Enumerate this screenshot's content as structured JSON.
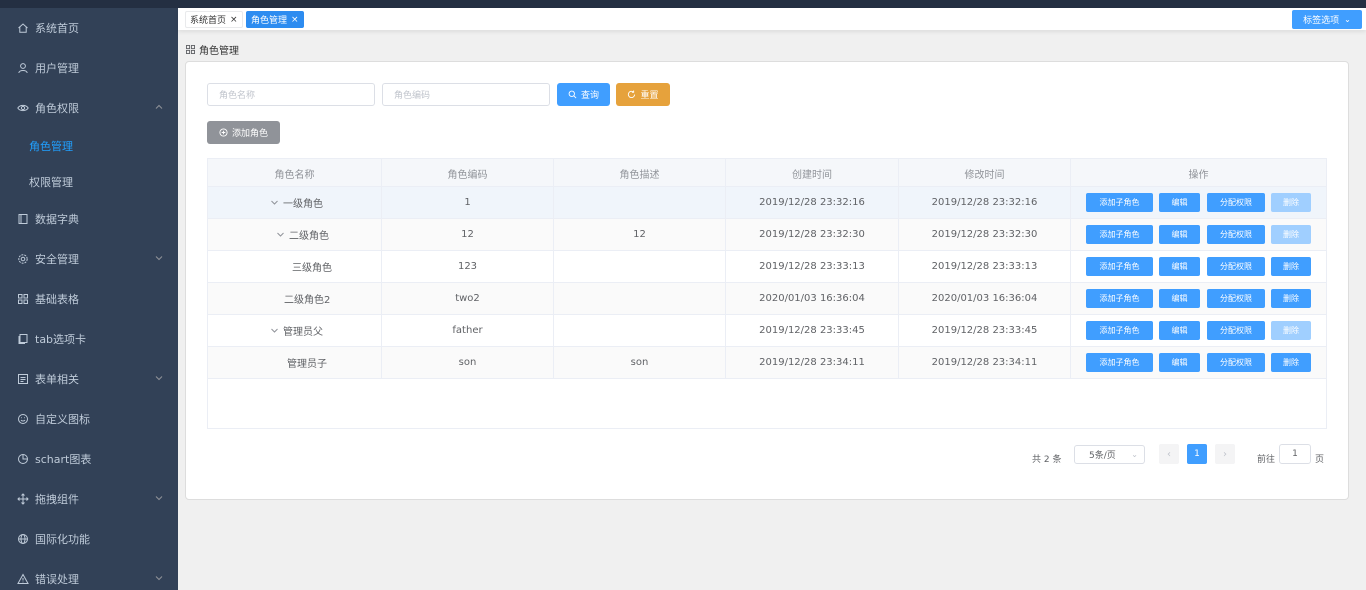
{
  "sidebar": {
    "items": [
      {
        "label": "系统首页",
        "icon": "home-icon"
      },
      {
        "label": "用户管理",
        "icon": "user-icon"
      },
      {
        "label": "角色权限",
        "icon": "eye-icon",
        "expanded": true
      },
      {
        "label": "数据字典",
        "icon": "notebook-icon"
      },
      {
        "label": "安全管理",
        "icon": "gear-icon"
      },
      {
        "label": "基础表格",
        "icon": "grid-icon"
      },
      {
        "label": "tab选项卡",
        "icon": "copy-icon"
      },
      {
        "label": "表单相关",
        "icon": "form-icon"
      },
      {
        "label": "自定义图标",
        "icon": "smile-icon"
      },
      {
        "label": "schart图表",
        "icon": "pie-chart-icon"
      },
      {
        "label": "拖拽组件",
        "icon": "rank-icon"
      },
      {
        "label": "国际化功能",
        "icon": "globe-icon"
      },
      {
        "label": "错误处理",
        "icon": "warning-icon"
      }
    ],
    "sub_items": [
      {
        "label": "角色管理",
        "active": true
      },
      {
        "label": "权限管理",
        "active": false
      }
    ]
  },
  "tags": {
    "items": [
      {
        "label": "系统首页",
        "close": "×",
        "active": false
      },
      {
        "label": "角色管理",
        "close": "×",
        "active": true
      }
    ],
    "options_label": "标签选项"
  },
  "breadcrumb": {
    "label": "角色管理"
  },
  "search": {
    "name_placeholder": "角色名称",
    "code_placeholder": "角色编码",
    "query_label": "查询",
    "reset_label": "重置"
  },
  "add_button_label": "添加角色",
  "table": {
    "headers": [
      "角色名称",
      "角色编码",
      "角色描述",
      "创建时间",
      "修改时间",
      "操作"
    ],
    "rows": [
      {
        "name": "一级角色",
        "code": "1",
        "desc": "",
        "created": "2019/12/28 23:32:16",
        "modified": "2019/12/28 23:32:16",
        "level": 0,
        "expandable": true,
        "delete_disabled": true
      },
      {
        "name": "二级角色",
        "code": "12",
        "desc": "12",
        "created": "2019/12/28 23:32:30",
        "modified": "2019/12/28 23:32:30",
        "level": 1,
        "expandable": true,
        "delete_disabled": true
      },
      {
        "name": "三级角色",
        "code": "123",
        "desc": "",
        "created": "2019/12/28 23:33:13",
        "modified": "2019/12/28 23:33:13",
        "level": 2,
        "expandable": false,
        "delete_disabled": false
      },
      {
        "name": "二级角色2",
        "code": "two2",
        "desc": "",
        "created": "2020/01/03 16:36:04",
        "modified": "2020/01/03 16:36:04",
        "level": 1,
        "expandable": false,
        "delete_disabled": false
      },
      {
        "name": "管理员父",
        "code": "father",
        "desc": "",
        "created": "2019/12/28 23:33:45",
        "modified": "2019/12/28 23:33:45",
        "level": 0,
        "expandable": true,
        "delete_disabled": true
      },
      {
        "name": "管理员子",
        "code": "son",
        "desc": "son",
        "created": "2019/12/28 23:34:11",
        "modified": "2019/12/28 23:34:11",
        "level": 1,
        "expandable": false,
        "delete_disabled": false
      }
    ],
    "actions": {
      "add_child": "添加子角色",
      "edit": "编辑",
      "assign": "分配权限",
      "delete": "删除"
    }
  },
  "pagination": {
    "total_label": "共 2 条",
    "page_size": "5条/页",
    "prev": "‹",
    "next": "›",
    "current_page": "1",
    "goto_label": "前往",
    "goto_value": "1",
    "page_unit": "页"
  },
  "colors": {
    "primary": "#409eff",
    "warning": "#e6a23c",
    "sidebar_bg": "#324157",
    "sidebar_active": "#20a0ff"
  }
}
